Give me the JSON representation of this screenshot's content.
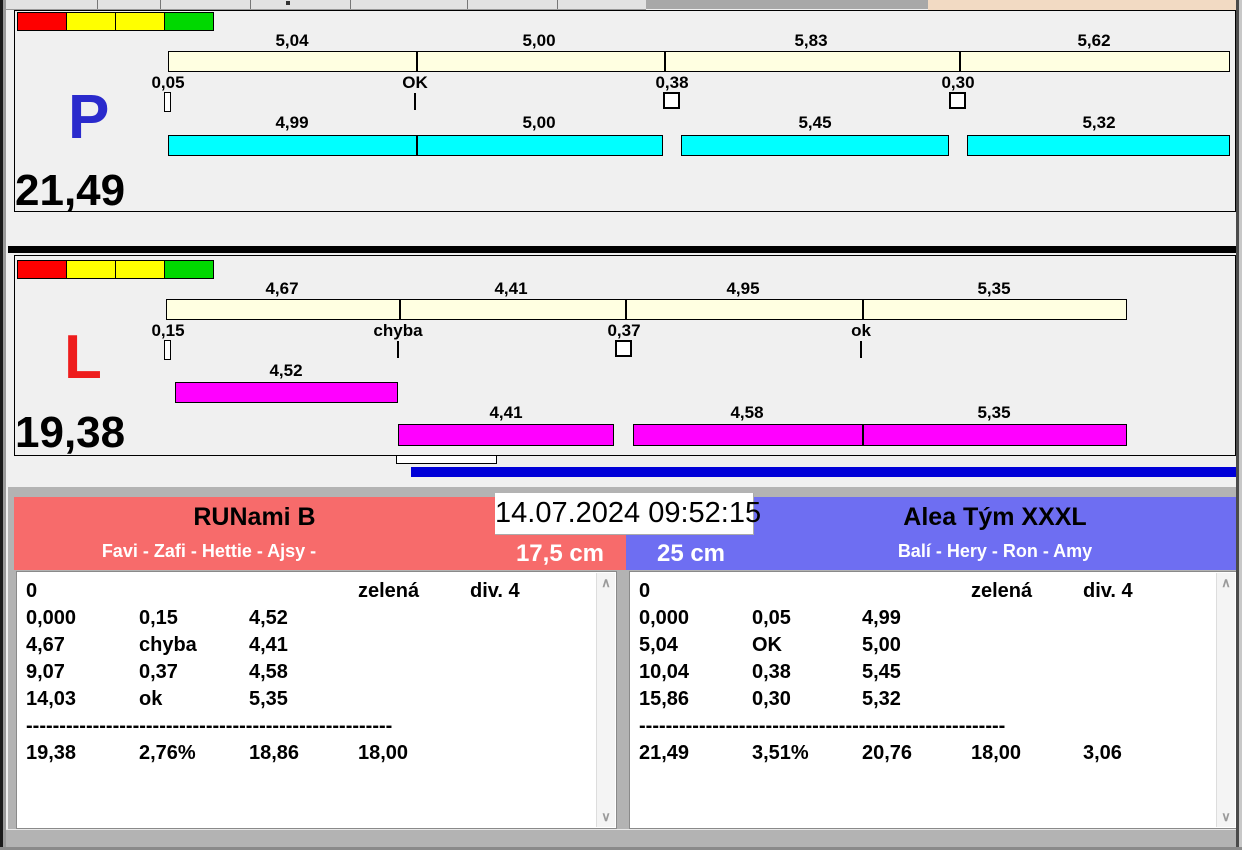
{
  "app": {
    "timestamp": "14.07.2024 09:52:15"
  },
  "colors": {
    "bar_cream": "#ffffe1",
    "bar_cyan": "#00ffff",
    "bar_magenta": "#ff00ff",
    "progress_blue": "#0000d8",
    "status_red": "#fe0000",
    "status_yellow": "#ffff00",
    "status_green": "#00d800",
    "letter_p": "#2a2acc",
    "letter_l": "#ee1c1c",
    "team_left_header": "#f76b6b",
    "team_right_header": "#6e6ef2"
  },
  "panel_p": {
    "letter": "P",
    "total": "21,49",
    "top_labels": [
      "5,04",
      "5,00",
      "5,83",
      "5,62"
    ],
    "mid_labels": [
      "0,05",
      "OK",
      "0,38",
      "0,30"
    ],
    "bottom_labels": [
      "4,99",
      "5,00",
      "5,45",
      "5,32"
    ]
  },
  "panel_l": {
    "letter": "L",
    "total": "19,38",
    "top_labels": [
      "4,67",
      "4,41",
      "4,95",
      "5,35"
    ],
    "mid_labels": [
      "0,15",
      "chyba",
      "0,37",
      "ok"
    ],
    "first_bar_label": "4,52",
    "bottom_labels": [
      "4,41",
      "4,58",
      "5,35"
    ]
  },
  "team_left": {
    "name": "RUNami B",
    "members": "Favi - Zafi - Hettie - Ajsy -",
    "jump_height": "17,5 cm",
    "rows": [
      [
        "0",
        "",
        "",
        "zelená",
        "div. 4"
      ],
      [
        "0,000",
        "0,15",
        "4,52",
        "",
        ""
      ],
      [
        "4,67",
        "chyba",
        "4,41",
        "",
        ""
      ],
      [
        "9,07",
        "0,37",
        "4,58",
        "",
        ""
      ],
      [
        "14,03",
        "ok",
        "5,35",
        "",
        ""
      ]
    ],
    "separator": "-------------------------------------------------------",
    "totals": [
      "19,38",
      "2,76%",
      "18,86",
      "18,00",
      ""
    ]
  },
  "team_right": {
    "name": "Alea Tým XXXL",
    "members": "Balí - Hery - Ron - Amy",
    "jump_height": "25 cm",
    "rows": [
      [
        "0",
        "",
        "",
        "zelená",
        "div. 4"
      ],
      [
        "0,000",
        "0,05",
        "4,99",
        "",
        ""
      ],
      [
        "5,04",
        "OK",
        "5,00",
        "",
        ""
      ],
      [
        "10,04",
        "0,38",
        "5,45",
        "",
        ""
      ],
      [
        "15,86",
        "0,30",
        "5,32",
        "",
        ""
      ]
    ],
    "separator": "-------------------------------------------------------",
    "totals": [
      "21,49",
      "3,51%",
      "20,76",
      "18,00",
      "3,06"
    ]
  }
}
